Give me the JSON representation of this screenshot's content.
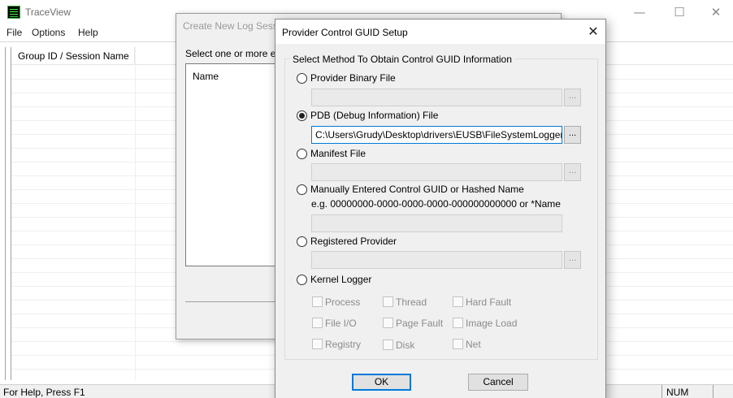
{
  "app": {
    "title": "TraceView",
    "window_controls": {
      "minimize": "—",
      "maximize": "☐",
      "close": "✕"
    }
  },
  "menu": {
    "items": [
      "File",
      "Options",
      "Help"
    ]
  },
  "session_list": {
    "column_header": "Group ID / Session Name"
  },
  "status_bar": {
    "text": "For Help, Press F1",
    "indicator": "NUM"
  },
  "background_dialog": {
    "title": "Create New Log Sessi",
    "prompt": "Select one or more ev",
    "list_column": "Name"
  },
  "dialog": {
    "title": "Provider Control GUID Setup",
    "close_glyph": "✕",
    "group_caption": "Select Method To Obtain Control GUID Information",
    "options": {
      "provider_binary": {
        "label": "Provider Binary File",
        "checked": false,
        "value": ""
      },
      "pdb": {
        "label": "PDB (Debug Information) File",
        "checked": true,
        "value": "C:\\Users\\Grudy\\Desktop\\drivers\\EUSB\\FileSystemLogger.pdb"
      },
      "manifest": {
        "label": "Manifest File",
        "checked": false,
        "value": ""
      },
      "manual_guid": {
        "label": "Manually Entered Control GUID or Hashed Name",
        "checked": false,
        "example": "e.g. 00000000-0000-0000-0000-000000000000 or *Name",
        "value": ""
      },
      "registered": {
        "label": "Registered Provider",
        "checked": false,
        "value": ""
      },
      "kernel": {
        "label": "Kernel Logger",
        "checked": false
      }
    },
    "browse_label": "...",
    "kernel_flags": {
      "process": "Process",
      "thread": "Thread",
      "hard_fault": "Hard Fault",
      "file_io": "File I/O",
      "page_fault": "Page Fault",
      "image_load": "Image Load",
      "registry": "Registry",
      "disk": "Disk",
      "net": "Net"
    },
    "buttons": {
      "ok": "OK",
      "cancel": "Cancel"
    }
  },
  "colors": {
    "focus_accent": "#0078d7",
    "dialog_bg": "#f0f0f0"
  }
}
